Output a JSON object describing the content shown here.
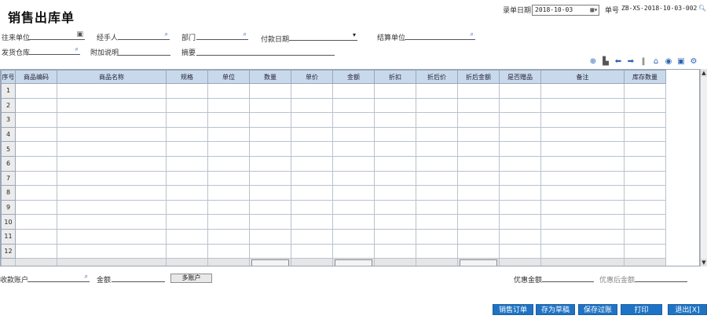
{
  "title": "销售出库单",
  "header": {
    "date_label": "录单日期",
    "date_value": "2018-10-03",
    "billno_label": "单号",
    "billno_value": "ZB-XS-2018-10-03-002"
  },
  "form": {
    "partner_label": "往来单位",
    "handler_label": "经手人",
    "dept_label": "部门",
    "paydate_label": "付款日期",
    "settle_label": "结算单位",
    "warehouse_label": "发货仓库",
    "note_label": "附加说明",
    "summary_label": "摘要"
  },
  "table": {
    "columns": [
      "序号",
      "商品编码",
      "商品名称",
      "规格",
      "单位",
      "数量",
      "单价",
      "金额",
      "折扣",
      "折后价",
      "折后金额",
      "是否赠品",
      "备注",
      "库存数量"
    ],
    "rows": [
      "1",
      "2",
      "3",
      "4",
      "5",
      "6",
      "7",
      "8",
      "9",
      "10",
      "11",
      "12"
    ]
  },
  "footer": {
    "account_label": "收款账户",
    "amount_label": "金额",
    "multi_account": "多账户",
    "discount_label": "优惠金额",
    "after_discount_label": "优惠后金额"
  },
  "actions": {
    "sales_order": "销售订单",
    "save_draft": "存为草稿[S]",
    "save_post": "保存过账[A]",
    "print": "打印",
    "exit": "退出[X]"
  },
  "icons": [
    "add-icon",
    "copy-icon",
    "arrow-left-icon",
    "arrow-right-icon",
    "barcode-icon",
    "home-icon",
    "target-icon",
    "save-icon",
    "gear-icon"
  ],
  "colors": {
    "header_bg": "#c9d9ec",
    "button_bg": "#1f73c4",
    "icon_blue": "#2b63b5"
  }
}
